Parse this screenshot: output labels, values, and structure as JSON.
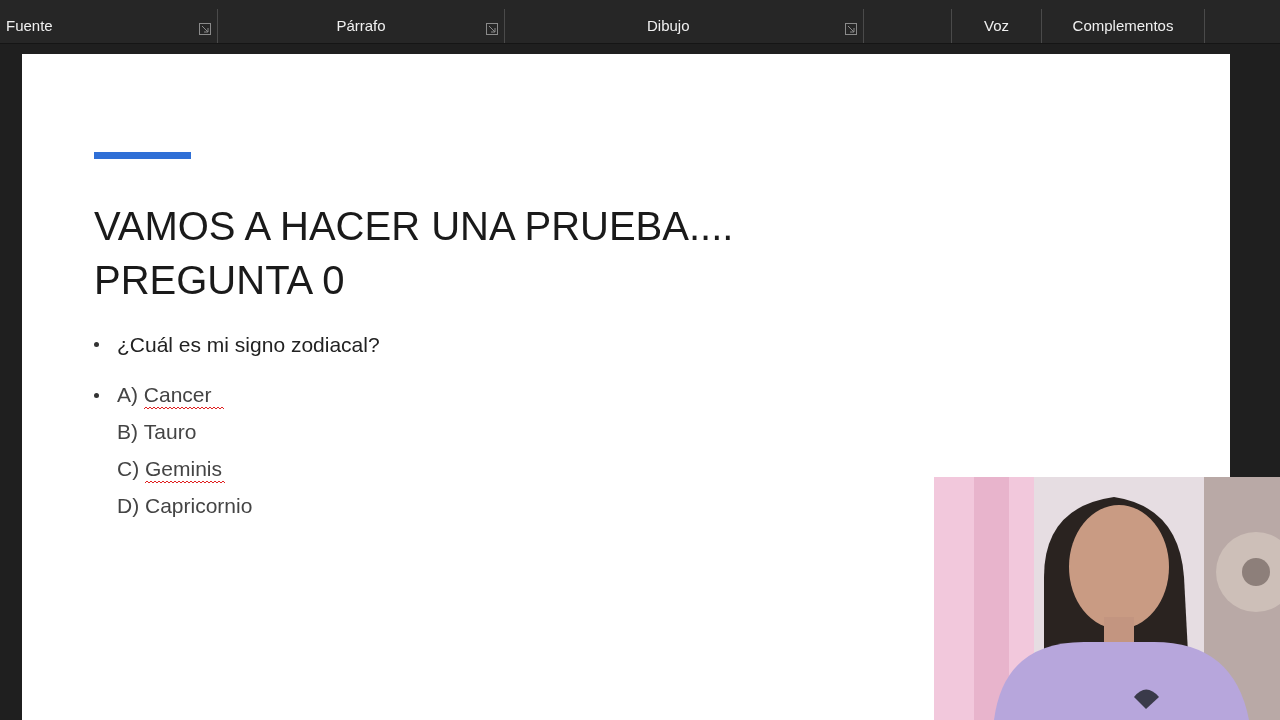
{
  "ribbon": {
    "groups": [
      {
        "label": "Fuente",
        "launcher": true
      },
      {
        "label": "Párrafo",
        "launcher": true
      },
      {
        "label": "Dibujo",
        "launcher": true
      },
      {
        "launcher": false
      },
      {
        "label": "Voz",
        "launcher": false
      },
      {
        "label": "Complementos",
        "launcher": false
      }
    ]
  },
  "slide": {
    "title_lines": [
      "VAMOS A HACER UNA PRUEBA....",
      "PREGUNTA 0"
    ],
    "question": {
      "text": "¿Cuál es mi signo zodiacal?",
      "bullet": true
    },
    "options": [
      {
        "letter": "A)",
        "text": "Cancer",
        "bullet": true,
        "spelling_error": true
      },
      {
        "letter": "B)",
        "text": "Tauro",
        "bullet": false,
        "spelling_error": false
      },
      {
        "letter": "C)",
        "text": "Geminis",
        "bullet": false,
        "spelling_error": true
      },
      {
        "letter": "D)",
        "text": "Capricornio",
        "bullet": false,
        "spelling_error": false
      }
    ]
  }
}
